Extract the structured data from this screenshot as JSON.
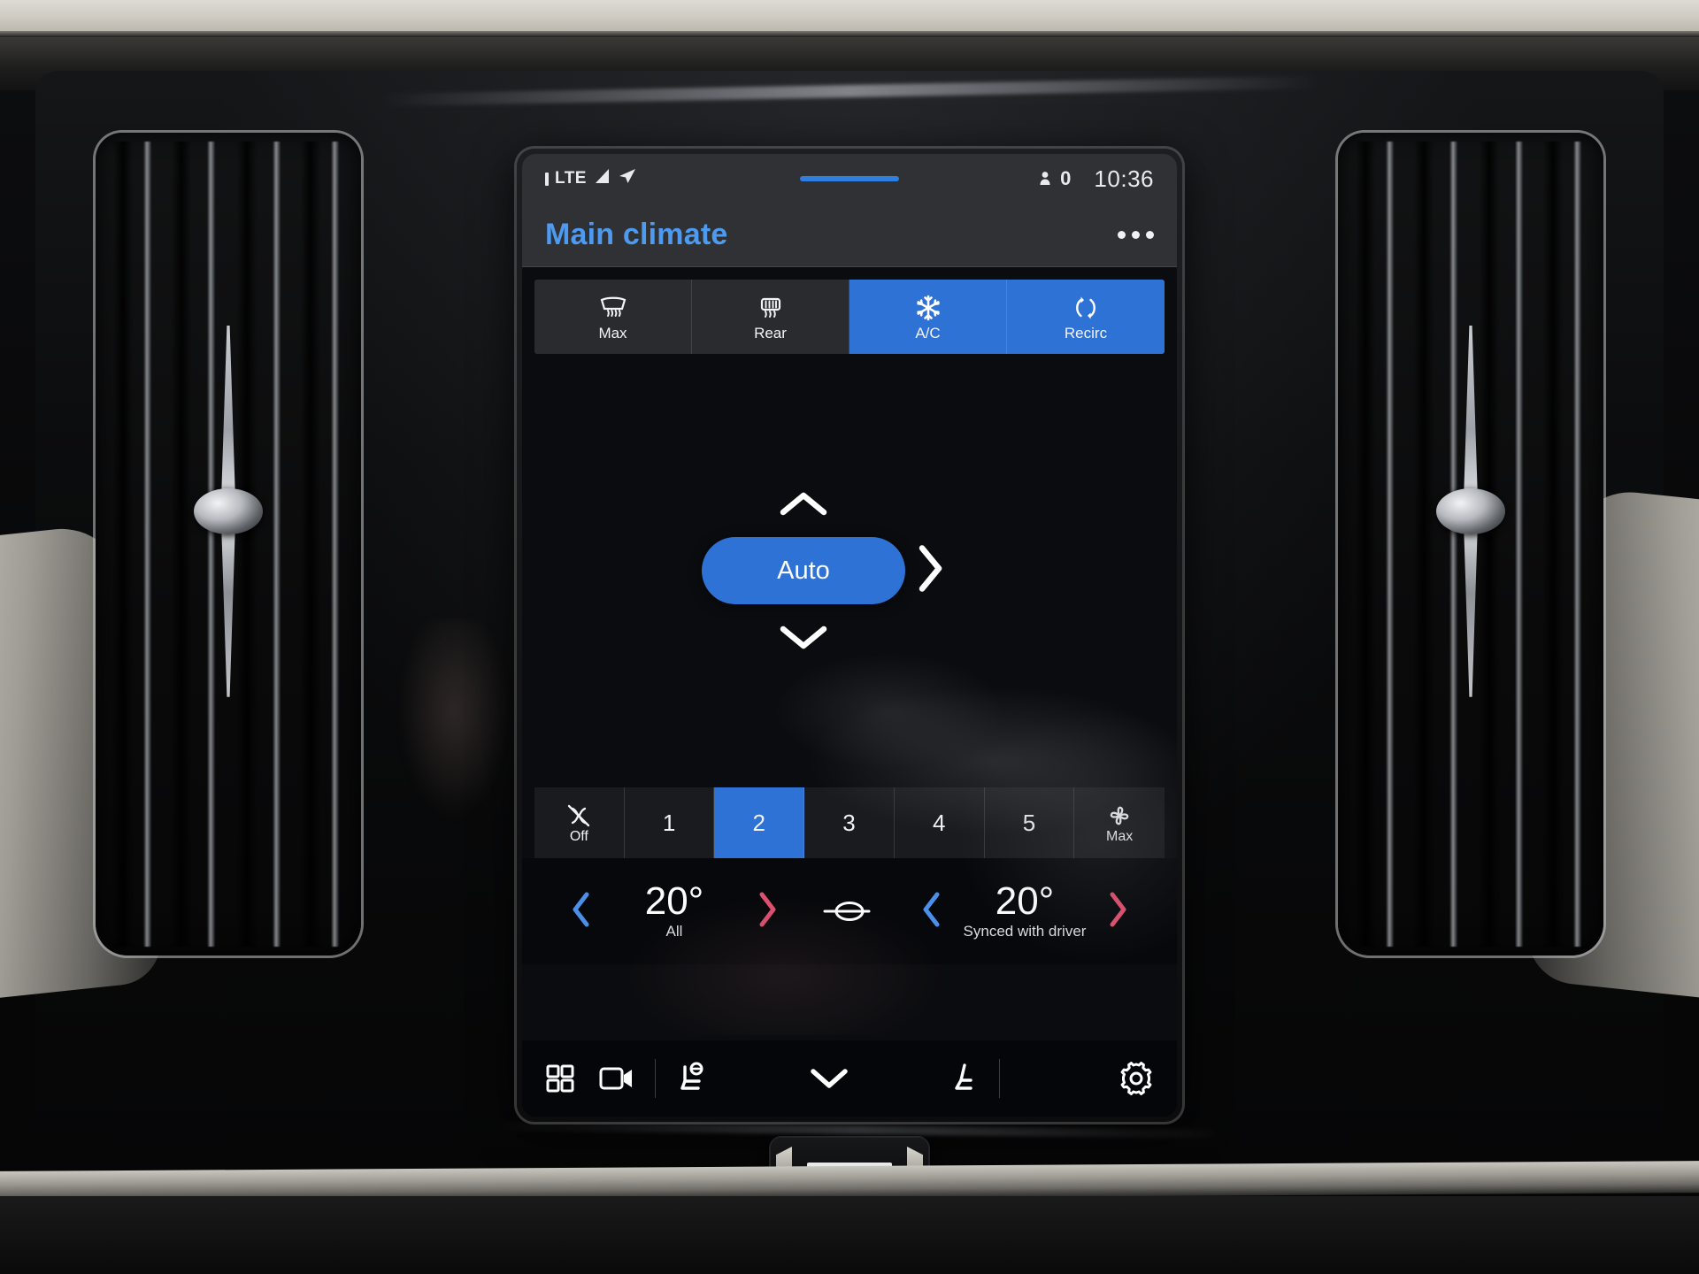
{
  "statusbar": {
    "signal_label": "LTE",
    "occupancy": "0",
    "time": "10:36",
    "signal_icon": "signal-bars-icon",
    "nav_icon": "navigation-arrow-icon",
    "occupancy_icon": "person-icon"
  },
  "header": {
    "title": "Main climate",
    "title_color": "#4d9bf0",
    "overflow_label": "more-options"
  },
  "quick_buttons": [
    {
      "label": "Max",
      "icon": "windshield-defrost-icon",
      "active": false
    },
    {
      "label": "Rear",
      "icon": "rear-defrost-icon",
      "active": false
    },
    {
      "label": "A/C",
      "icon": "snowflake-icon",
      "active": true
    },
    {
      "label": "Recirc",
      "icon": "recirculate-icon",
      "active": true
    }
  ],
  "airflow": {
    "auto_label": "Auto",
    "auto_active": true,
    "up_icon": "chevron-up-icon",
    "down_icon": "chevron-down-icon",
    "right_icon": "chevron-right-icon"
  },
  "fan": {
    "levels": [
      {
        "label": "Off",
        "icon": "fan-off-icon",
        "active": false
      },
      {
        "label": "1",
        "icon": null,
        "active": false
      },
      {
        "label": "2",
        "icon": null,
        "active": true
      },
      {
        "label": "3",
        "icon": null,
        "active": false
      },
      {
        "label": "4",
        "icon": null,
        "active": false
      },
      {
        "label": "5",
        "icon": null,
        "active": false
      },
      {
        "label": "Max",
        "icon": "fan-icon",
        "active": false
      }
    ]
  },
  "temperature": {
    "left": {
      "value": "20°",
      "label": "All"
    },
    "right": {
      "value": "20°",
      "label": "Synced with driver"
    },
    "sync_icon": "temperature-sync-icon",
    "decrease_icon": "chevron-left-icon",
    "increase_icon": "chevron-right-icon",
    "cool_color": "#4a8fe8",
    "warm_color": "#e0506f"
  },
  "bottom_nav": [
    {
      "name": "apps-grid-icon",
      "label": "Apps"
    },
    {
      "name": "camera-icon",
      "label": "Camera"
    },
    {
      "name": "driver-seat-icon",
      "label": "Driver seat climate"
    },
    {
      "name": "chevron-down-icon",
      "label": "Collapse"
    },
    {
      "name": "passenger-seat-icon",
      "label": "Passenger seat climate"
    },
    {
      "name": "gear-icon",
      "label": "Settings"
    }
  ],
  "theme": {
    "accent_blue": "#2f72d6",
    "panel_grey": "#303134",
    "screen_black": "#07080b"
  },
  "hardware": {
    "hazard_button": "hazard-lights-button",
    "vent_left": "air-vent-left",
    "vent_right": "air-vent-right"
  }
}
